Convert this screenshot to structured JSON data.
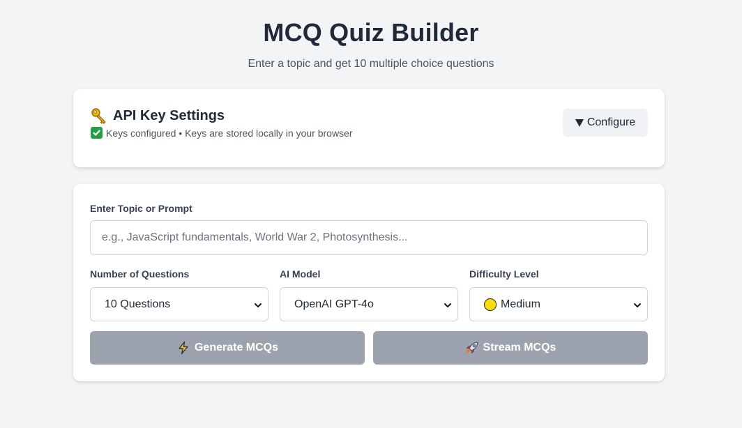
{
  "header": {
    "title": "MCQ Quiz Builder",
    "subtitle": "Enter a topic and get 10 multiple choice questions"
  },
  "api_settings": {
    "icon": "key-icon",
    "title": "API Key Settings",
    "status_icon": "check-icon",
    "status_text": "Keys configured • Keys are stored locally in your browser",
    "configure_label": "Configure",
    "configure_icon": "triangle-down-icon"
  },
  "form": {
    "topic_label": "Enter Topic or Prompt",
    "topic_placeholder": "e.g., JavaScript fundamentals, World War 2, Photosynthesis...",
    "topic_value": "",
    "num_questions": {
      "label": "Number of Questions",
      "selected": "10 Questions"
    },
    "ai_model": {
      "label": "AI Model",
      "selected": "OpenAI GPT-4o"
    },
    "difficulty": {
      "label": "Difficulty Level",
      "selected": "Medium",
      "icon": "yellow-circle-icon"
    },
    "generate_button": {
      "label": "Generate MCQs",
      "icon": "lightning-icon"
    },
    "stream_button": {
      "label": "Stream MCQs",
      "icon": "rocket-icon"
    }
  },
  "colors": {
    "background": "#f3f4f6",
    "card": "#ffffff",
    "disabled_button": "#9ca3af",
    "check_green": "#22a045",
    "medium_yellow": "#ffdd00"
  }
}
